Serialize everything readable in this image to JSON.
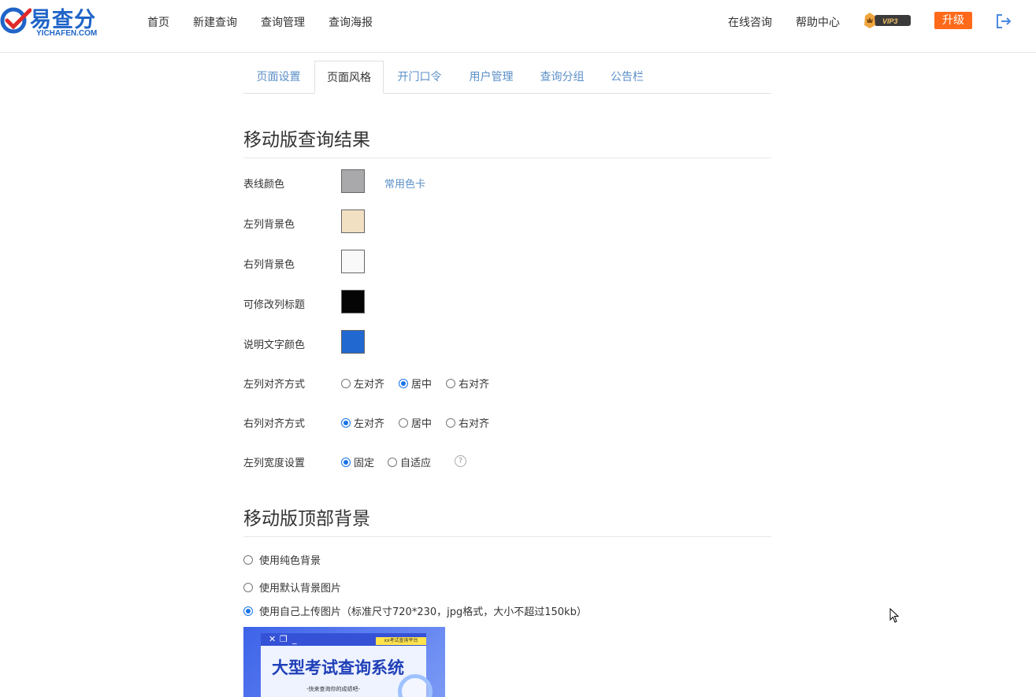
{
  "header": {
    "logo_cn": "易查分",
    "logo_en": "YICHAFEN.COM",
    "nav": [
      "首页",
      "新建查询",
      "查询管理",
      "查询海报"
    ],
    "online_consult": "在线咨询",
    "help_center": "帮助中心",
    "vip_label": "VIP3",
    "upgrade": "升级"
  },
  "tabs": [
    "页面设置",
    "页面风格",
    "开门口令",
    "用户管理",
    "查询分组",
    "公告栏"
  ],
  "active_tab": "页面风格",
  "mobile_result": {
    "title": "移动版查询结果",
    "line_color_label": "表线颜色",
    "line_color": "#a9a9ab",
    "common_colors_link": "常用色卡",
    "left_bg_label": "左列背景色",
    "left_bg": "#f2e0c2",
    "right_bg_label": "右列背景色",
    "right_bg": "#f9f9f9",
    "editable_title_label": "可修改列标题",
    "editable_title": "#050505",
    "desc_text_label": "说明文字颜色",
    "desc_text": "#2168d1",
    "left_align_label": "左列对齐方式",
    "left_align_options": [
      "左对齐",
      "居中",
      "右对齐"
    ],
    "left_align_selected": "居中",
    "right_align_label": "右列对齐方式",
    "right_align_options": [
      "左对齐",
      "居中",
      "右对齐"
    ],
    "right_align_selected": "左对齐",
    "left_width_label": "左列宽度设置",
    "left_width_options": [
      "固定",
      "自适应"
    ],
    "left_width_selected": "固定",
    "help_mark": "?"
  },
  "mobile_top_bg": {
    "title": "移动版顶部背景",
    "options": [
      "使用纯色背景",
      "使用默认背景图片",
      "使用自己上传图片（标准尺寸720*230，jpg格式，大小不超过150kb）"
    ],
    "selected": "使用自己上传图片（标准尺寸720*230，jpg格式，大小不超过150kb）",
    "preview_badge": "xx考试查询平台",
    "preview_title": "大型考试查询系统",
    "preview_sub": "-快来查询你的成绩吧-"
  }
}
